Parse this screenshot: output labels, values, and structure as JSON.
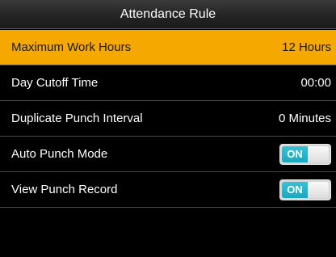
{
  "header": {
    "title": "Attendance Rule"
  },
  "rows": [
    {
      "label": "Maximum Work Hours",
      "value": "12 Hours"
    },
    {
      "label": "Day Cutoff Time",
      "value": "00:00"
    },
    {
      "label": "Duplicate Punch Interval",
      "value": "0 Minutes"
    },
    {
      "label": "Auto Punch Mode",
      "toggle_label": "ON",
      "toggle_on": true
    },
    {
      "label": "View Punch Record",
      "toggle_label": "ON",
      "toggle_on": true
    }
  ],
  "colors": {
    "selected_row": "#f5a800",
    "toggle_on": "#1aa8be",
    "background": "#000000"
  }
}
